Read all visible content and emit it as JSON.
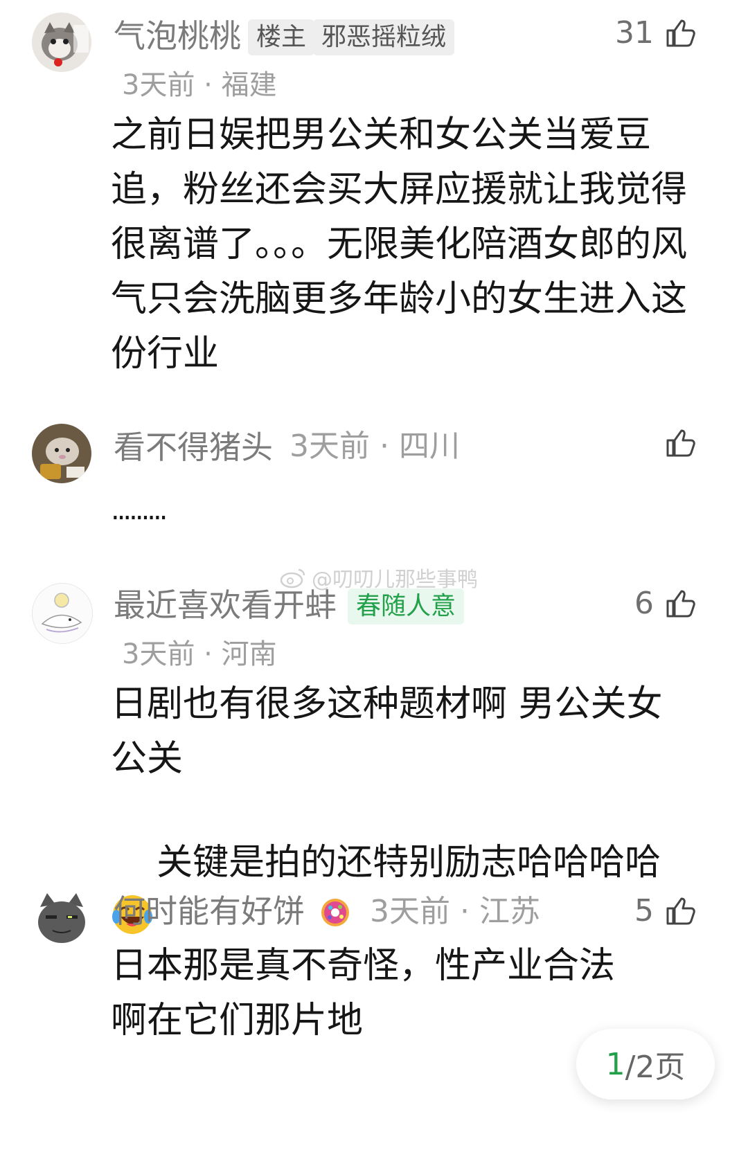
{
  "comments": [
    {
      "username": "气泡桃桃",
      "tags": [
        "楼主",
        "邪恶摇粒绒"
      ],
      "time_location": "3天前 · 福建",
      "likes": "31",
      "text": "之前日娱把男公关和女公关当爱豆追，粉丝还会买大屏应援就让我觉得很离谱了。。。无限美化陪酒女郎的风气只会洗脑更多年龄小的女生进入这份行业",
      "avatar_icon": "cat-avatar-icon"
    },
    {
      "username": "看不得猪头",
      "time_location": "3天前 · 四川",
      "likes": "",
      "text": ".........",
      "avatar_icon": "hamster-avatar-icon"
    },
    {
      "username": "最近喜欢看开蚌",
      "tags": [
        "春随人意"
      ],
      "time_location": "3天前 · 河南",
      "likes": "6",
      "text_line1": "日剧也有很多这种题材啊 男公关女公关",
      "text_line2": "关键是拍的还特别励志哈哈哈哈",
      "emoji": "laughing-crying-emoji",
      "avatar_icon": "sketch-avatar-icon"
    },
    {
      "username": "何时能有好饼",
      "badge_icon": "colorful-donut-badge-icon",
      "time_location": "3天前 · 江苏",
      "likes": "5",
      "text": "日本那是真不奇怪，性产业合法啊在它们那片地",
      "avatar_icon": "gray-cat-avatar-icon"
    }
  ],
  "watermark": "@叨叨儿那些事鸭",
  "pager": {
    "current": "1",
    "rest": "/2页"
  },
  "colors": {
    "accent_green": "#23a04a",
    "meta_gray": "#9e9e9e",
    "name_gray": "#7b7b7b"
  }
}
